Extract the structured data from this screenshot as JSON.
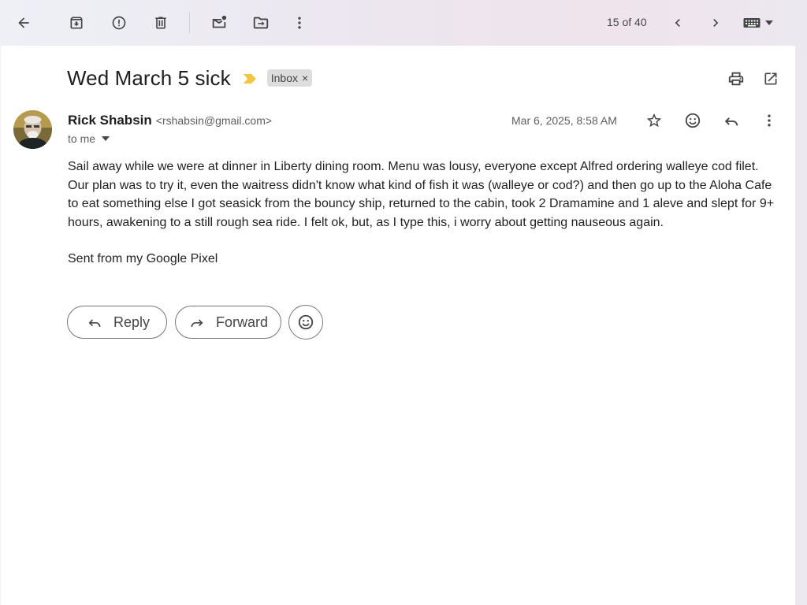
{
  "toolbar": {
    "icons": [
      "back-icon",
      "archive-icon",
      "report-spam-icon",
      "delete-icon",
      "mark-unread-icon",
      "move-to-icon",
      "more-vert-icon"
    ],
    "counter": "15 of 40"
  },
  "message": {
    "subject": "Wed March 5 sick",
    "label_chip": "Inbox",
    "label_chip_close": "×",
    "sender_name": "Rick Shabsin",
    "sender_email": "<rshabsin@gmail.com>",
    "recipient": "to me",
    "date": "Mar 6, 2025, 8:58 AM",
    "body": "Sail away while we were at dinner in Liberty dining room. Menu was lousy, everyone except Alfred ordering walleye cod filet. Our plan was to try it, even the waitress didn't know what kind of fish it was (walleye or cod?) and then go up to the Aloha Cafe to eat something else  I got seasick from the bouncy ship, returned to the cabin, took 2 Dramamine and 1 aleve and slept for 9+ hours, awakening to a still rough sea ride. I felt ok, but, as I type this, i worry about getting nauseous again.",
    "signature": "Sent from my Google Pixel"
  },
  "actions": {
    "reply_label": "Reply",
    "forward_label": "Forward"
  },
  "colors": {
    "importance_marker": "#f4c542",
    "chip_bg": "#dddddd",
    "icon": "#444746"
  }
}
